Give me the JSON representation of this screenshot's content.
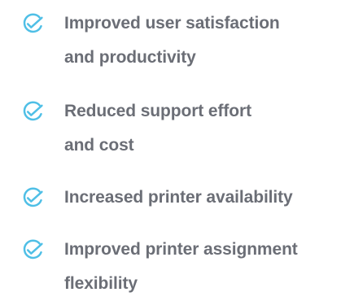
{
  "icons": {
    "check_icon": "check-circle-icon",
    "accent_color": "#4fbfe6",
    "text_color": "#6b6e76"
  },
  "benefits": [
    {
      "lines": [
        "Improved user satisfaction",
        "and productivity"
      ]
    },
    {
      "lines": [
        "Reduced support effort",
        "and cost"
      ]
    },
    {
      "lines": [
        "Increased printer availability"
      ]
    },
    {
      "lines": [
        "Improved printer assignment",
        "flexibility"
      ]
    }
  ]
}
